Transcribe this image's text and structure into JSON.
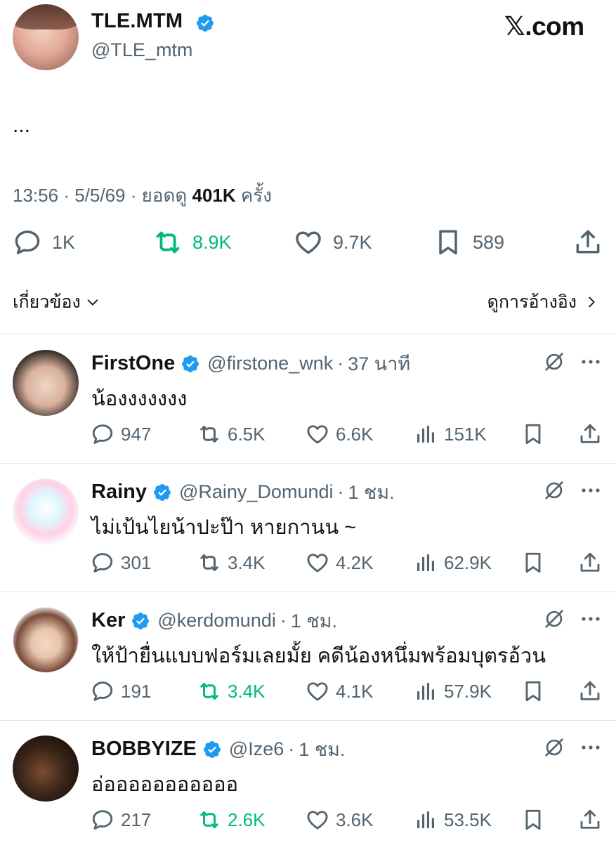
{
  "brand": "𝕏.com",
  "post": {
    "display_name": "TLE.MTM",
    "handle": "@TLE_mtm",
    "text": "...",
    "time": "13:56",
    "date": "5/5/69",
    "views_label": "ยอดดู",
    "views_count": "401K",
    "views_unit": "ครั้ง",
    "replies": "1K",
    "reposts": "8.9K",
    "likes": "9.7K",
    "bookmarks": "589"
  },
  "nav": {
    "related_label": "เกี่ยวข้อง",
    "quotes_label": "ดูการอ้างอิง"
  },
  "colors": {
    "verified": "#1d9bf0",
    "repost_active": "#00ba7c",
    "icon_gray": "#536471",
    "text": "#0f1419"
  },
  "replies": [
    {
      "name": "FirstOne",
      "handle": "@firstone_wnk",
      "time": "37 นาที",
      "text": "น้องงงงงงง",
      "replies": "947",
      "reposts": "6.5K",
      "reposted": false,
      "likes": "6.6K",
      "views": "151K"
    },
    {
      "name": "Rainy",
      "handle": "@Rainy_Domundi",
      "time": "1 ชม.",
      "text": "ไม่เป้นไยน้าปะป๊า หายกานน ~",
      "replies": "301",
      "reposts": "3.4K",
      "reposted": false,
      "likes": "4.2K",
      "views": "62.9K"
    },
    {
      "name": "Ker",
      "handle": "@kerdomundi",
      "time": "1 ชม.",
      "text": "ให้ป้ายื่นแบบฟอร์มเลยมั้ย คดีน้องหนึ่มพร้อมบุตรอ้วน",
      "replies": "191",
      "reposts": "3.4K",
      "reposted": true,
      "likes": "4.1K",
      "views": "57.9K"
    },
    {
      "name": "BOBBYIZE",
      "handle": "@Ize6",
      "time": "1 ชม.",
      "text": "อ่อออออออออออ",
      "replies": "217",
      "reposts": "2.6K",
      "reposted": true,
      "likes": "3.6K",
      "views": "53.5K"
    }
  ]
}
